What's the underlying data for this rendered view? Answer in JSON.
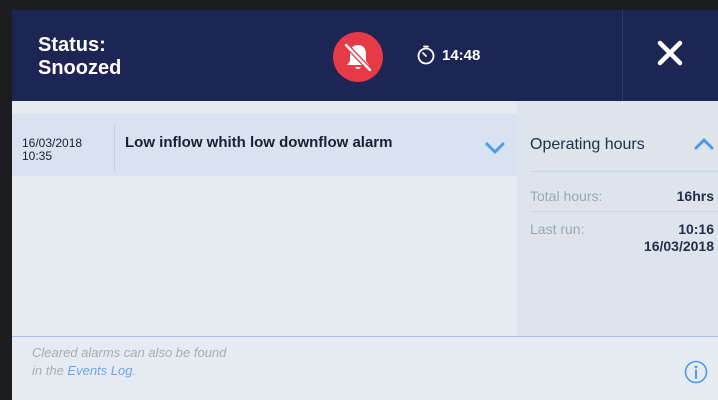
{
  "header": {
    "status_line1": "Status:",
    "status_line2": "Snoozed",
    "bell_icon": "bell-slash-icon",
    "timer_icon": "stopwatch-icon",
    "time": "14:48",
    "close_icon": "close-icon"
  },
  "alarm": {
    "date": "16/03/2018",
    "time": "10:35",
    "message": "Low inflow whith low downflow alarm",
    "expand_icon": "chevron-down-icon"
  },
  "operating_hours": {
    "title": "Operating hours",
    "collapse_icon": "chevron-up-icon",
    "total_label": "Total hours:",
    "total_value": "16hrs",
    "last_run_label": "Last run:",
    "last_run_time": "10:16",
    "last_run_date": "16/03/2018"
  },
  "footer": {
    "note_line1": "Cleared alarms can also be found",
    "note_prefix": "in the ",
    "events_link": "Events Log",
    "note_suffix": ".",
    "info_icon": "info-icon"
  },
  "colors": {
    "header_bg": "#1c2554",
    "alarm_red": "#e63a46",
    "accent_blue": "#4a9bea"
  }
}
